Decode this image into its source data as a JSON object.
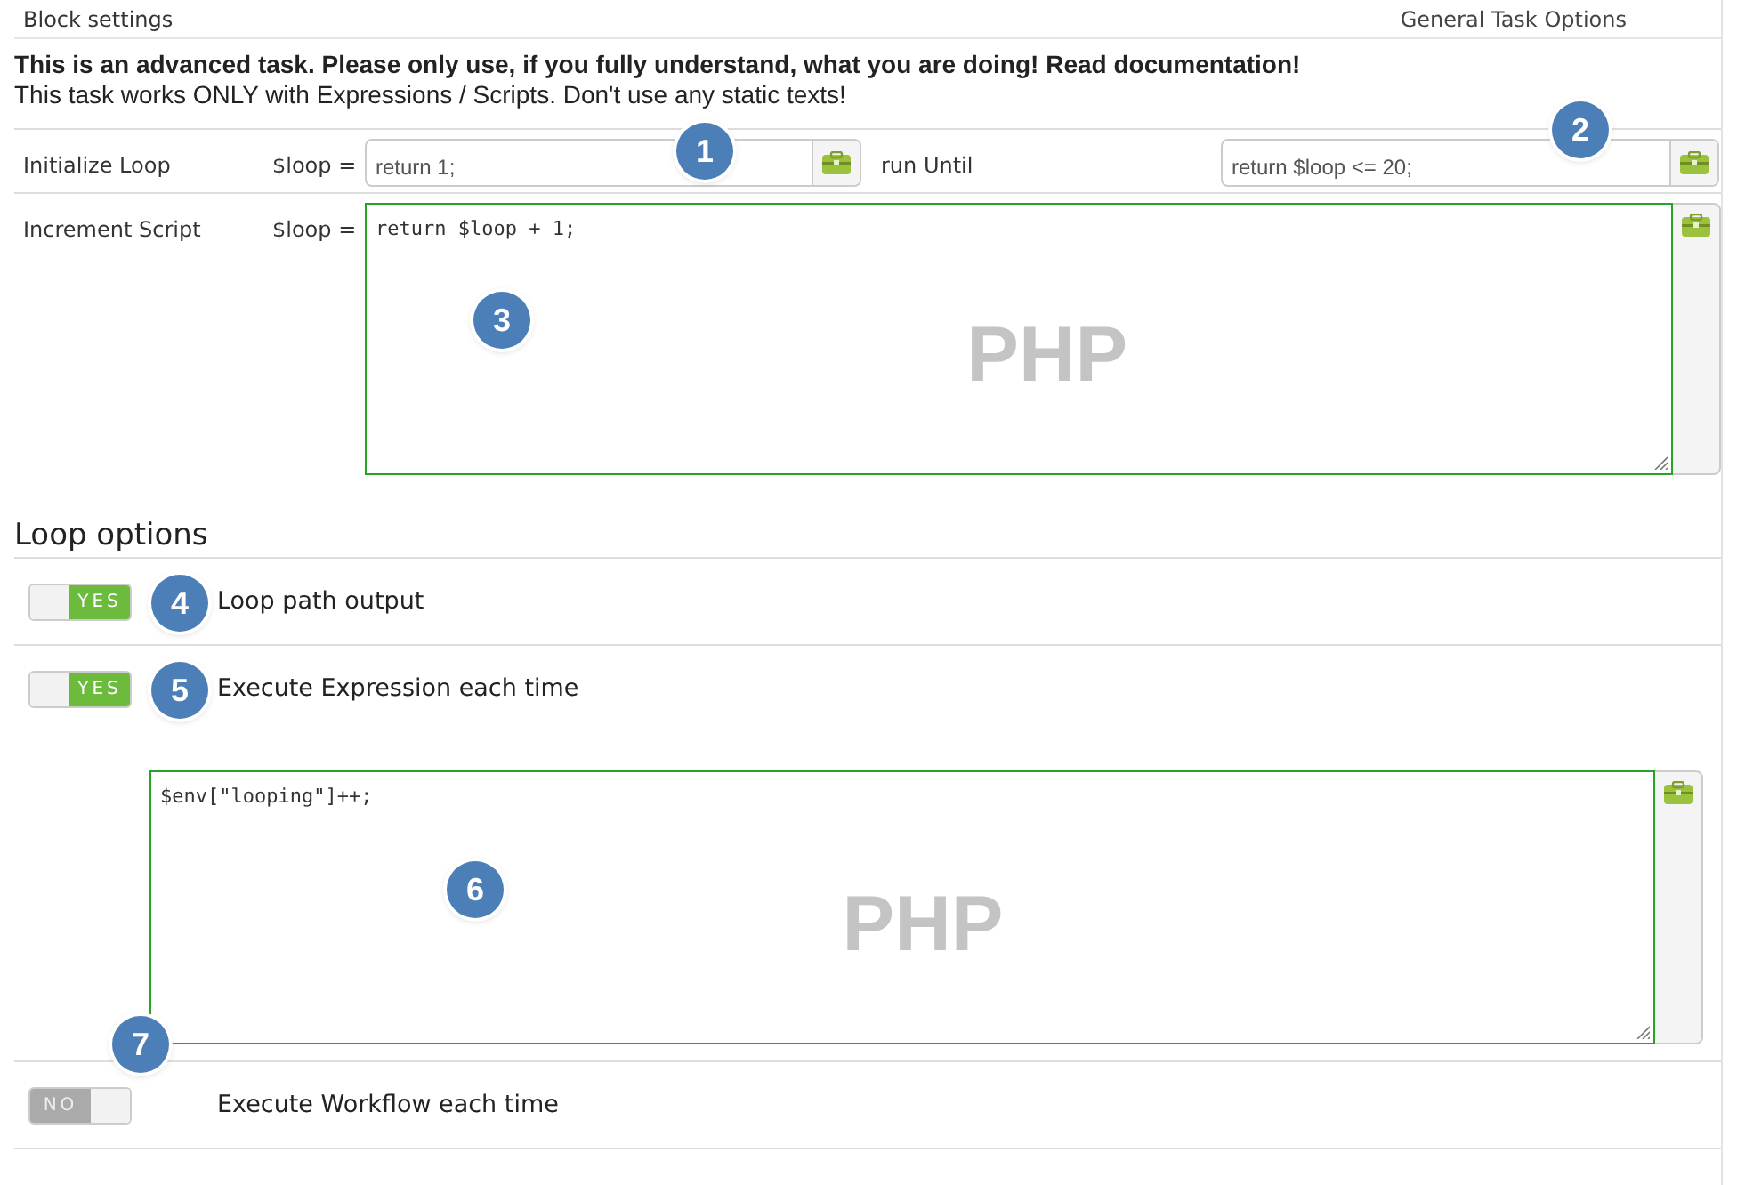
{
  "header": {
    "title": "Block settings",
    "right_link": "General Task Options"
  },
  "notice": {
    "warning": "This is an advanced task. Please only use, if you fully understand, what you are doing! Read documentation!",
    "info": "This task works ONLY with Expressions / Scripts. Don't use any static texts!"
  },
  "init": {
    "label": "Initialize Loop",
    "prefix": "$loop =",
    "value": "return 1;"
  },
  "until": {
    "label": "run Until",
    "value": "return $loop <= 20;"
  },
  "increment": {
    "label": "Increment Script",
    "prefix": "$loop =",
    "value": "return $loop + 1;",
    "mode_label": "PHP"
  },
  "section_title": "Loop options",
  "options": [
    {
      "label": "Loop path output",
      "on": true,
      "toggle_text": "YES"
    },
    {
      "label": "Execute Expression each time",
      "on": true,
      "toggle_text": "YES",
      "editor": {
        "value": "$env[\"looping\"]++;",
        "mode_label": "PHP"
      }
    },
    {
      "label": "Execute Workflow each time",
      "on": false,
      "toggle_text": "NO"
    }
  ],
  "callouts": [
    "1",
    "2",
    "3",
    "4",
    "5",
    "6",
    "7"
  ]
}
